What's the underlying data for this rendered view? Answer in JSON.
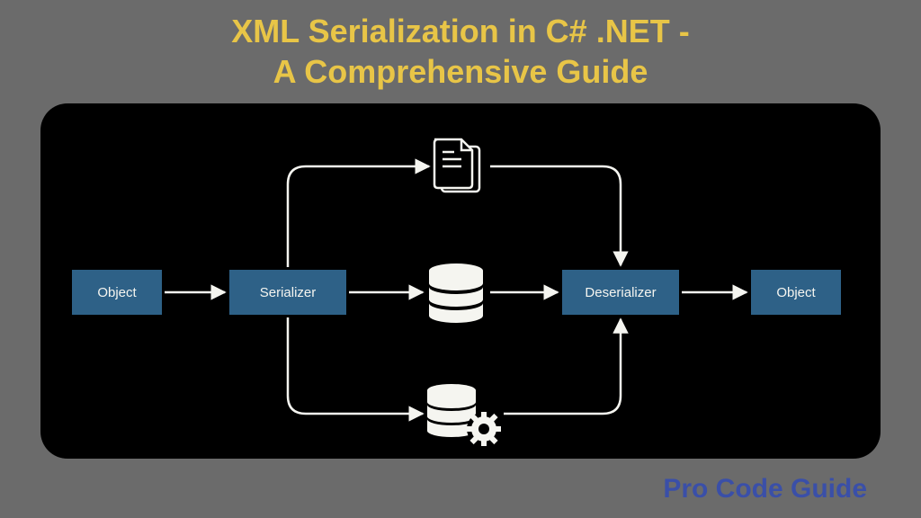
{
  "title_line1": "XML Serialization in C# .NET -",
  "title_line2": "A Comprehensive Guide",
  "branding": "Pro Code Guide",
  "nodes": {
    "object_left": "Object",
    "serializer": "Serializer",
    "deserializer": "Deserializer",
    "object_right": "Object"
  },
  "colors": {
    "background": "#6b6b6b",
    "panel": "#000000",
    "title": "#e8c547",
    "node": "#2e6187",
    "branding": "#3a4fa8",
    "stroke": "#f5f5f0"
  }
}
